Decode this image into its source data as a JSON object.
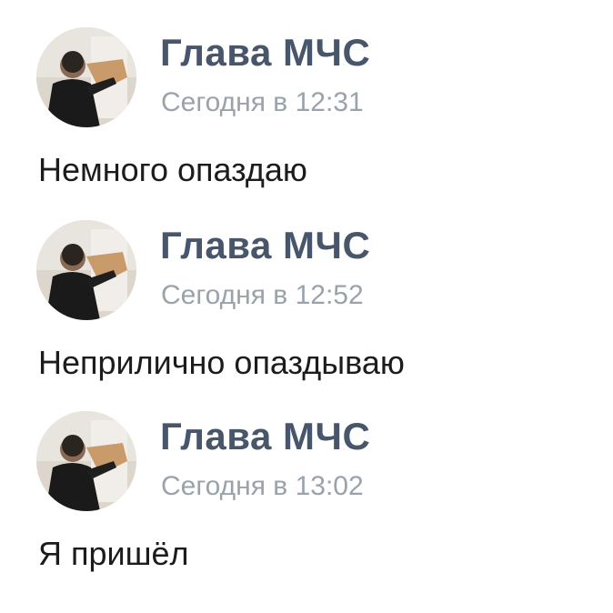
{
  "messages": [
    {
      "author": "Глава МЧС",
      "time": "Сегодня в 12:31",
      "text": "Немного опаздаю"
    },
    {
      "author": "Глава МЧС",
      "time": "Сегодня в 12:52",
      "text": "Неприлично опаздываю"
    },
    {
      "author": "Глава МЧС",
      "time": "Сегодня в 13:02",
      "text": "Я пришёл"
    }
  ],
  "colors": {
    "author": "#47566b",
    "time": "#9aa2ab",
    "text": "#1c1c1c",
    "background": "#ffffff"
  },
  "icons": {
    "avatar": "avatar-photo-icon"
  }
}
